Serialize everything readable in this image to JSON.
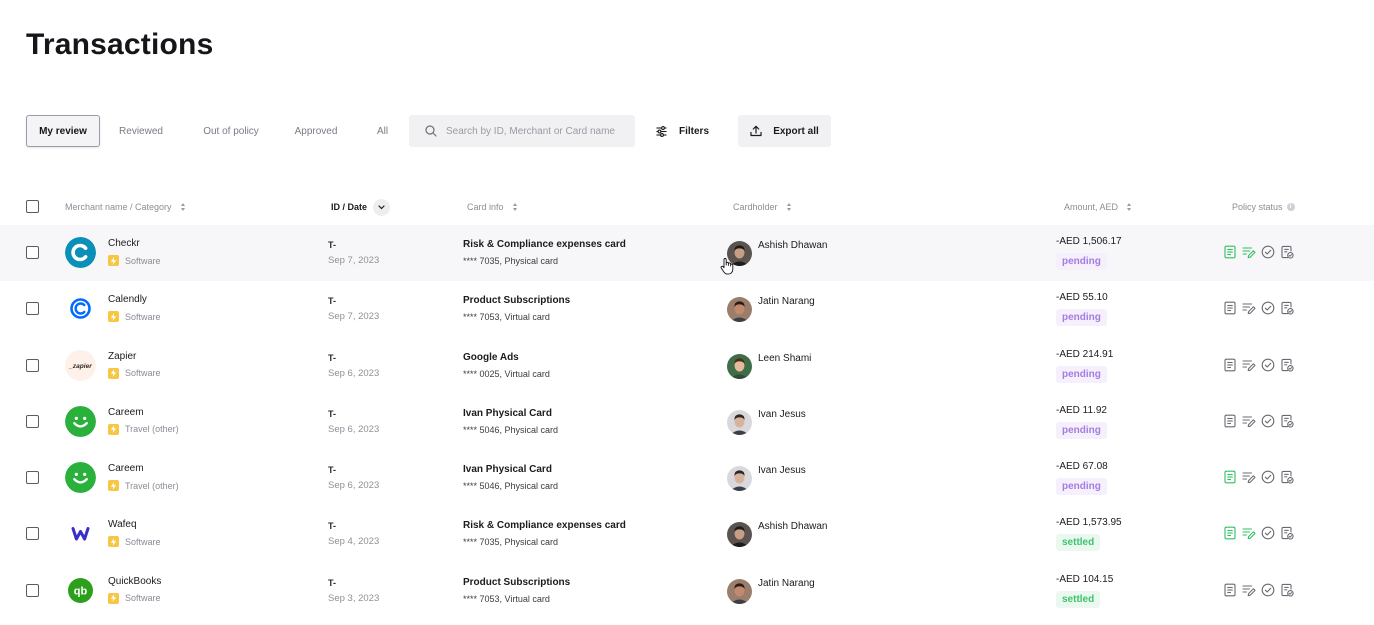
{
  "page": {
    "title": "Transactions"
  },
  "toolbar": {
    "tabs": [
      {
        "label": "My review",
        "active": true
      },
      {
        "label": "Reviewed",
        "active": false
      },
      {
        "label": "Out of policy",
        "active": false
      },
      {
        "label": "Approved",
        "active": false
      },
      {
        "label": "All",
        "active": false
      }
    ],
    "search_placeholder": "Search by ID, Merchant or Card name",
    "filters_label": "Filters",
    "export_label": "Export all"
  },
  "table": {
    "columns": {
      "merchant": "Merchant name / Category",
      "iddate": "ID / Date",
      "card": "Card info",
      "cardholder": "Cardholder",
      "amount": "Amount, AED",
      "policy": "Policy status"
    },
    "rows": [
      {
        "merchant": "Checkr",
        "logo": "checkr-logo",
        "category": "Software",
        "id": "T-",
        "date": "Sep 7, 2023",
        "card_name": "Risk & Compliance expenses card",
        "card_sub": "**** 7035, Physical card",
        "cardholder": "Ashish Dhawan",
        "amount": "-AED 1,506.17",
        "status": "pending",
        "receipt_done": true,
        "notes_done": true
      },
      {
        "merchant": "Calendly",
        "logo": "calendly-logo",
        "category": "Software",
        "id": "T-",
        "date": "Sep 7, 2023",
        "card_name": "Product Subscriptions",
        "card_sub": "**** 7053, Virtual card",
        "cardholder": "Jatin Narang",
        "amount": "-AED 55.10",
        "status": "pending",
        "receipt_done": false,
        "notes_done": false
      },
      {
        "merchant": "Zapier",
        "logo": "zapier-logo",
        "category": "Software",
        "id": "T-",
        "date": "Sep 6, 2023",
        "card_name": "Google Ads",
        "card_sub": "**** 0025, Virtual card",
        "cardholder": "Leen Shami",
        "amount": "-AED 214.91",
        "status": "pending",
        "receipt_done": false,
        "notes_done": false
      },
      {
        "merchant": "Careem",
        "logo": "careem-logo",
        "category": "Travel (other)",
        "id": "T-",
        "date": "Sep 6, 2023",
        "card_name": "Ivan Physical Card",
        "card_sub": "**** 5046, Physical card",
        "cardholder": "Ivan Jesus",
        "amount": "-AED 11.92",
        "status": "pending",
        "receipt_done": false,
        "notes_done": false
      },
      {
        "merchant": "Careem",
        "logo": "careem-logo",
        "category": "Travel (other)",
        "id": "T-",
        "date": "Sep 6, 2023",
        "card_name": "Ivan Physical Card",
        "card_sub": "**** 5046, Physical card",
        "cardholder": "Ivan Jesus",
        "amount": "-AED 67.08",
        "status": "pending",
        "receipt_done": true,
        "notes_done": false
      },
      {
        "merchant": "Wafeq",
        "logo": "wafeq-logo",
        "category": "Software",
        "id": "T-",
        "date": "Sep 4, 2023",
        "card_name": "Risk & Compliance expenses card",
        "card_sub": "**** 7035, Physical card",
        "cardholder": "Ashish Dhawan",
        "amount": "-AED 1,573.95",
        "status": "settled",
        "receipt_done": true,
        "notes_done": true
      },
      {
        "merchant": "QuickBooks",
        "logo": "quickbooks-logo",
        "category": "Software",
        "id": "T-",
        "date": "Sep 3, 2023",
        "card_name": "Product Subscriptions",
        "card_sub": "**** 7053, Virtual card",
        "cardholder": "Jatin Narang",
        "amount": "-AED 104.15",
        "status": "settled",
        "receipt_done": false,
        "notes_done": false
      }
    ]
  },
  "colors": {
    "pending_text": "#a57ce0",
    "settled_text": "#3fc46e",
    "done_icon": "#2fbf63",
    "todo_icon": "#6a6a73"
  }
}
